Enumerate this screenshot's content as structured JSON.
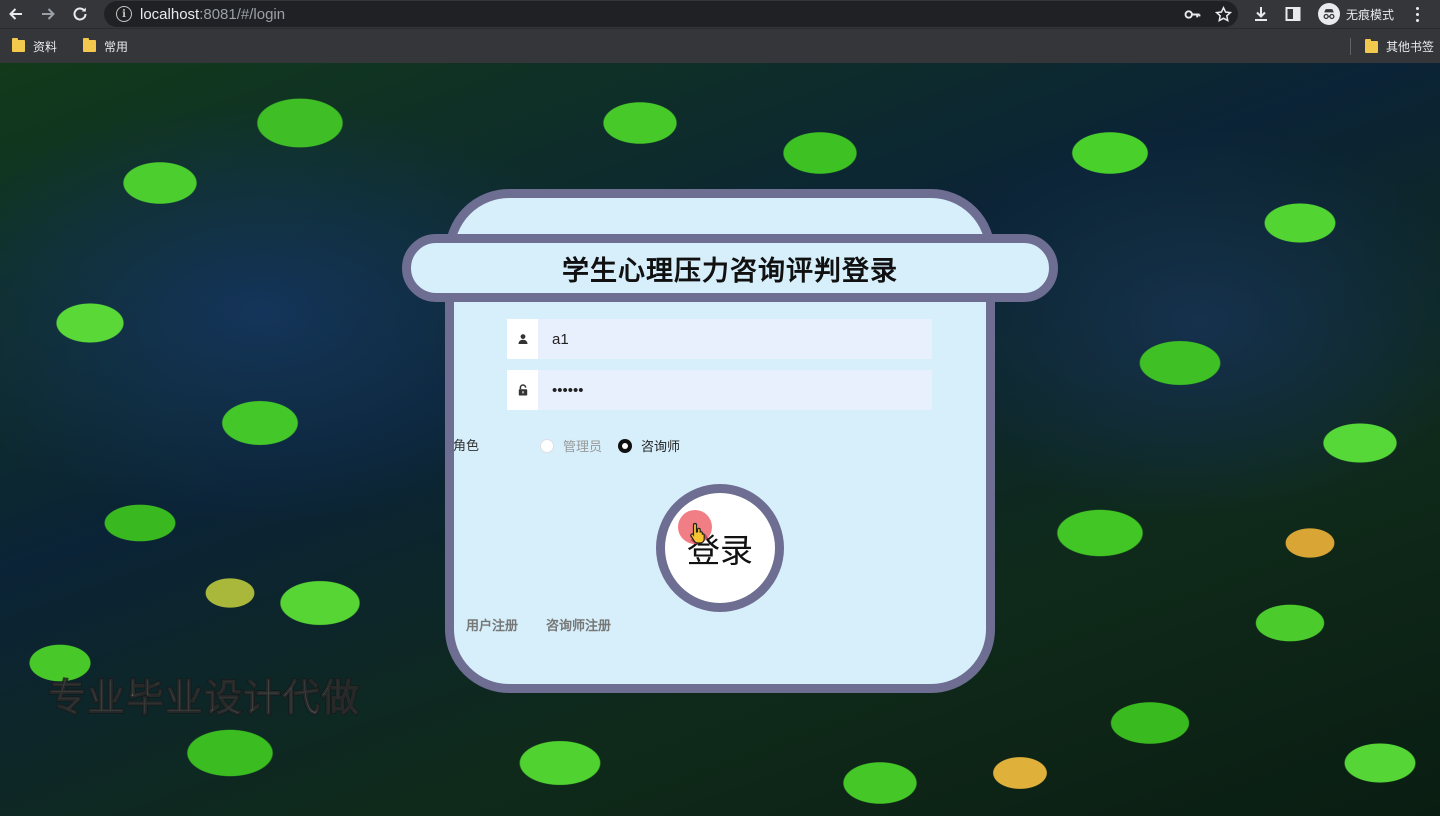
{
  "browser": {
    "url_host": "localhost",
    "url_rest": ":8081/#/login",
    "incognito_label": "无痕模式",
    "bookmarks": [
      {
        "label": "资料"
      },
      {
        "label": "常用"
      }
    ],
    "other_bookmarks": "其他书签"
  },
  "login": {
    "title": "学生心理压力咨询评判登录",
    "username_value": "a1",
    "password_value": "111111",
    "role_label": "角色",
    "roles": [
      {
        "label": "管理员",
        "checked": false
      },
      {
        "label": "咨询师",
        "checked": true
      }
    ],
    "login_button": "登录",
    "register_user": "用户注册",
    "register_counselor": "咨询师注册"
  },
  "watermark": "专业毕业设计代做",
  "icons": {
    "back": "arrow-left-icon",
    "forward": "arrow-right-icon",
    "reload": "reload-icon",
    "info": "info-icon",
    "key": "key-icon",
    "star": "star-icon",
    "download": "download-icon",
    "sidepanel": "side-panel-icon",
    "incognito": "incognito-icon",
    "menu": "kebab-menu-icon",
    "folder": "folder-icon",
    "user": "user-icon",
    "lock": "lock-icon",
    "cursor": "hand-cursor-icon"
  },
  "colors": {
    "card_bg": "#d6effb",
    "card_border": "#6e6d92",
    "input_bg": "#e8f0fd",
    "chrome_bg": "#35363a"
  }
}
